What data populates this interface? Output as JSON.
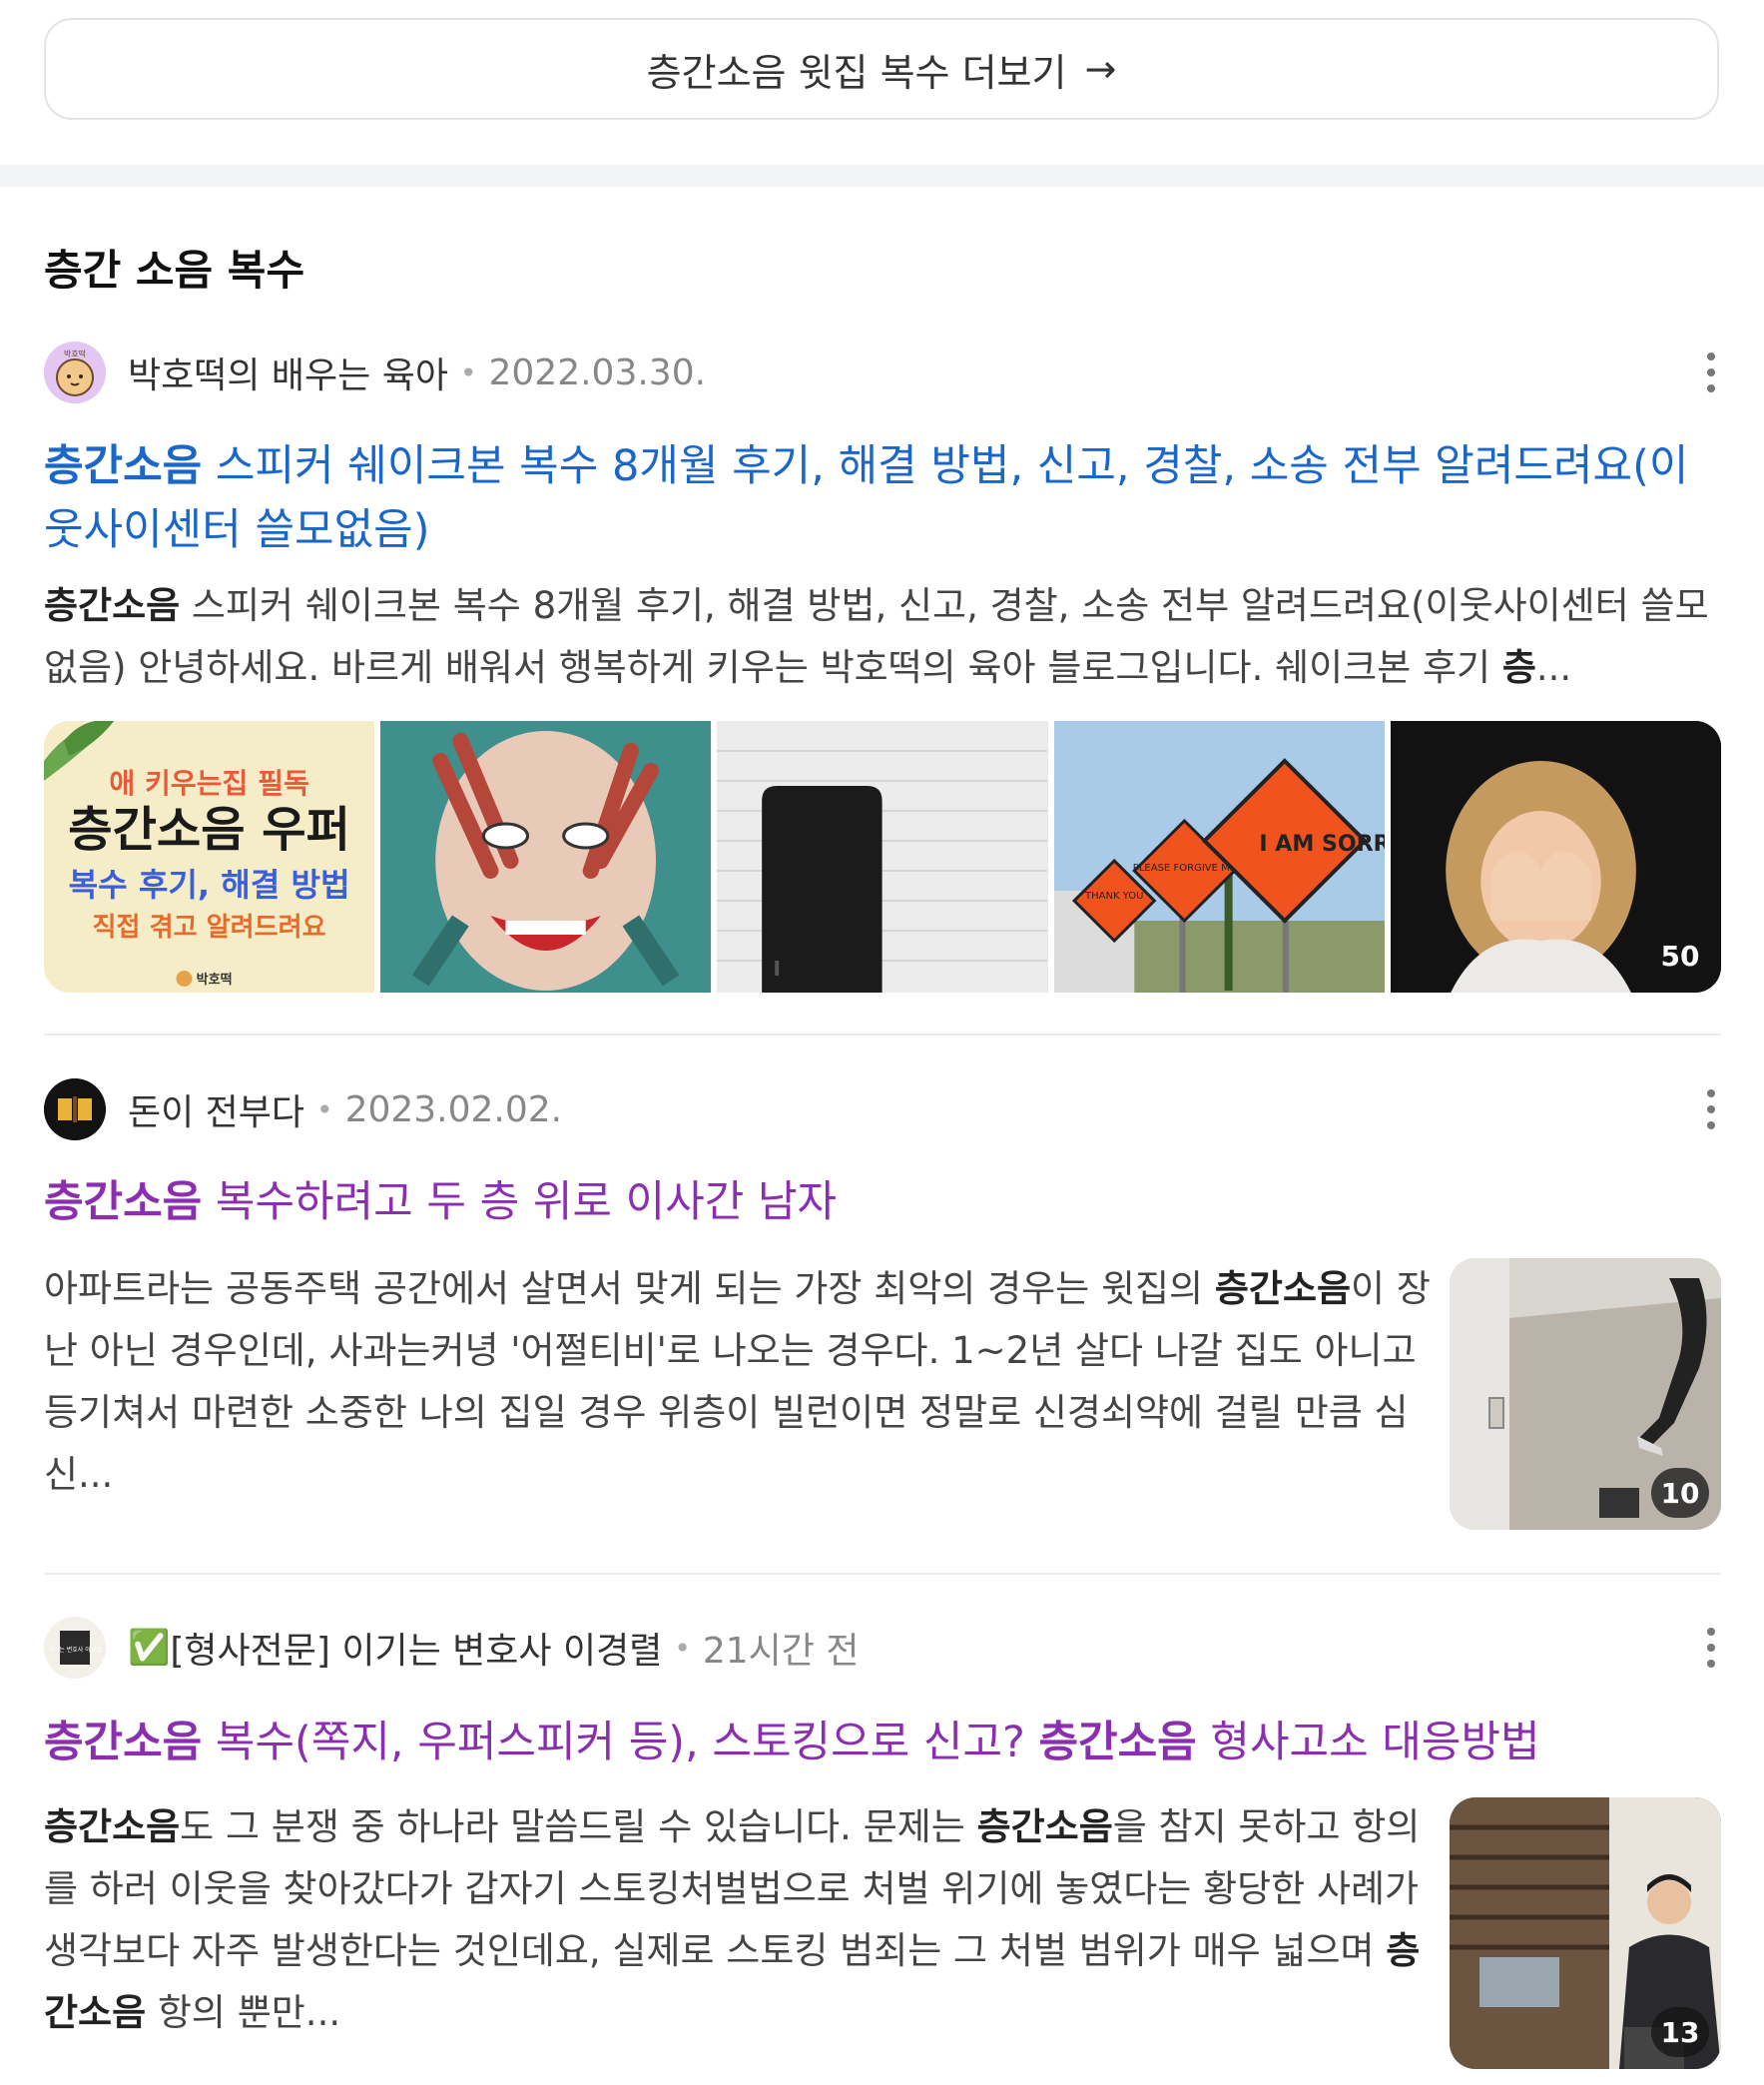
{
  "more_button": {
    "label": "층간소음 윗집 복수 더보기",
    "arrow": "→"
  },
  "section": {
    "title": "층간 소음 복수"
  },
  "posts": [
    {
      "author": "박호떡의 배우는 육아",
      "date": "2022.03.30.",
      "title_hl": "층간소음",
      "title_rest": " 스피커 쉐이크본 복수 8개월 후기, 해결 방법, 신고, 경찰, 소송 전부 알려드려요(이웃사이센터 쓸모없음)",
      "snippet_hl": "층간소음",
      "snippet_rest": " 스피커 쉐이크본 복수 8개월 후기, 해결 방법, 신고, 경찰, 소송 전부 알려드려요(이웃사이센터 쓸모없음) 안녕하세요. 바르게 배워서 행복하게 키우는 박호떡의 육아 블로그입니다. 쉐이크본 후기 ",
      "snippet_tail_hl": "층",
      "snippet_ellipsis": "...",
      "image_count": "50",
      "poster": {
        "line1": "애 키우는집 필독",
        "line2": "층간소음 우퍼",
        "line3": "복수 후기, 해결 방법",
        "line4": "직접 겪고 알려드려요",
        "line5": "박호떡"
      },
      "sign": {
        "a": "THANK YOU",
        "b": "PLEASE FORGIVE ME",
        "c": "I AM SORR"
      },
      "avatar_text": "박호떡"
    },
    {
      "author": "돈이 전부다",
      "date": "2023.02.02.",
      "title_hl": "층간소음",
      "title_rest": " 복수하려고 두 층 위로 이사간 남자",
      "snippet_a": "아파트라는 공동주택 공간에서 살면서 맞게 되는 가장 최악의 경우는 윗집의 ",
      "snippet_hl": "층간소음",
      "snippet_b": "이 장난 아닌 경우인데, 사과는커녕 '어쩔티비'로 나오는 경우다. 1~2년 살다 나갈 집도 아니고 등기쳐서 마련한 소중한 나의 집일 경우 위층이 빌런이면 정말로 신경쇠약에 걸릴 만큼 심신...",
      "image_count": "10"
    },
    {
      "author_badge": "✅",
      "author": "[형사전문] 이기는 변호사 이경렬",
      "date": "21시간 전",
      "title_hl1": "층간소음",
      "title_mid": " 복수(쪽지, 우퍼스피커 등), 스토킹으로 신고? ",
      "title_hl2": "층간소음",
      "title_end": " 형사고소 대응방법",
      "snippet_hl1": "층간소음",
      "snippet_a": "도 그 분쟁 중 하나라 말씀드릴 수 있습니다. 문제는 ",
      "snippet_hl2": "층간소음",
      "snippet_b": "을 참지 못하고 항의를 하러 이웃을 찾아갔다가 갑자기 스토킹처벌법으로 처벌 위기에 놓였다는 황당한 사례가 생각보다 자주 발생한다는 것인데요, 실제로 스토킹 범죄는 그 처벌 범위가 매우 넓으며 ",
      "snippet_hl3": "층간소음",
      "snippet_c": " 항의 뿐만...",
      "image_count": "13",
      "avatar_text": "이기는 변호사 이경렬"
    }
  ],
  "colors": {
    "title_blue": "#1a66c9",
    "title_purple": "#8b2fb0"
  }
}
